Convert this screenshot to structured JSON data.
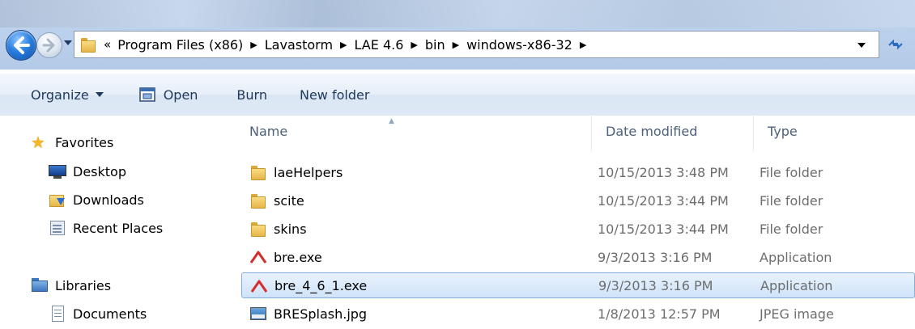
{
  "address_bar": {
    "overflow": "«",
    "crumbs": [
      "Program Files (x86)",
      "Lavastorm",
      "LAE 4.6",
      "bin",
      "windows-x86-32"
    ]
  },
  "commandbar": {
    "organize": "Organize",
    "open": "Open",
    "burn": "Burn",
    "new_folder": "New folder"
  },
  "nav_pane": {
    "favorites": "Favorites",
    "desktop": "Desktop",
    "downloads": "Downloads",
    "recent_places": "Recent Places",
    "libraries": "Libraries",
    "documents": "Documents"
  },
  "columns": {
    "name": "Name",
    "date_modified": "Date modified",
    "type": "Type"
  },
  "files": [
    {
      "name": "laeHelpers",
      "date": "10/15/2013 3:48 PM",
      "type": "File folder",
      "icon": "folder-icon"
    },
    {
      "name": "scite",
      "date": "10/15/2013 3:44 PM",
      "type": "File folder",
      "icon": "folder-icon"
    },
    {
      "name": "skins",
      "date": "10/15/2013 3:44 PM",
      "type": "File folder",
      "icon": "folder-icon"
    },
    {
      "name": "bre.exe",
      "date": "9/3/2013 3:16 PM",
      "type": "Application",
      "icon": "application-icon"
    },
    {
      "name": "bre_4_6_1.exe",
      "date": "9/3/2013 3:16 PM",
      "type": "Application",
      "icon": "application-icon",
      "selected": true
    },
    {
      "name": "BRESplash.jpg",
      "date": "1/8/2013 12:57 PM",
      "type": "JPEG image",
      "icon": "jpeg-image-icon"
    }
  ],
  "colors": {
    "selection_fill": "#cfe3f9",
    "selection_border": "#84acdd",
    "app_icon": "#d42d2d"
  }
}
